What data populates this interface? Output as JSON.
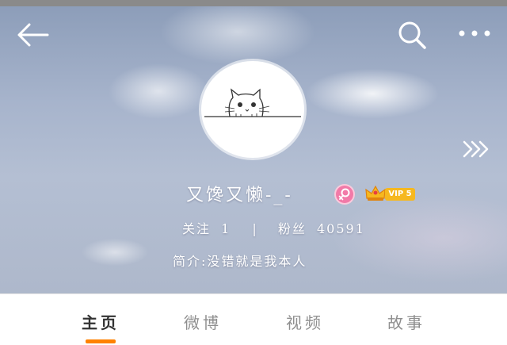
{
  "header": {
    "back_icon": "arrow-left-icon",
    "search_icon": "search-icon",
    "more_icon": "more-dots-icon",
    "next_icon": "chevrons-right-icon"
  },
  "profile": {
    "username": "又馋又懒-_-",
    "gender_icon": "female-icon",
    "vip_label": "VIP 5",
    "following_label": "关注",
    "following_count": "1",
    "separator": "|",
    "followers_label": "粉丝",
    "followers_count": "40591",
    "bio": "简介:没错就是我本人"
  },
  "tabs": [
    {
      "label": "主页",
      "active": true
    },
    {
      "label": "微博",
      "active": false
    },
    {
      "label": "视频",
      "active": false
    },
    {
      "label": "故事",
      "active": false
    }
  ],
  "colors": {
    "accent": "#ff8200",
    "gender_badge": "#f27aa8",
    "vip_gold": "#f6b81f"
  }
}
